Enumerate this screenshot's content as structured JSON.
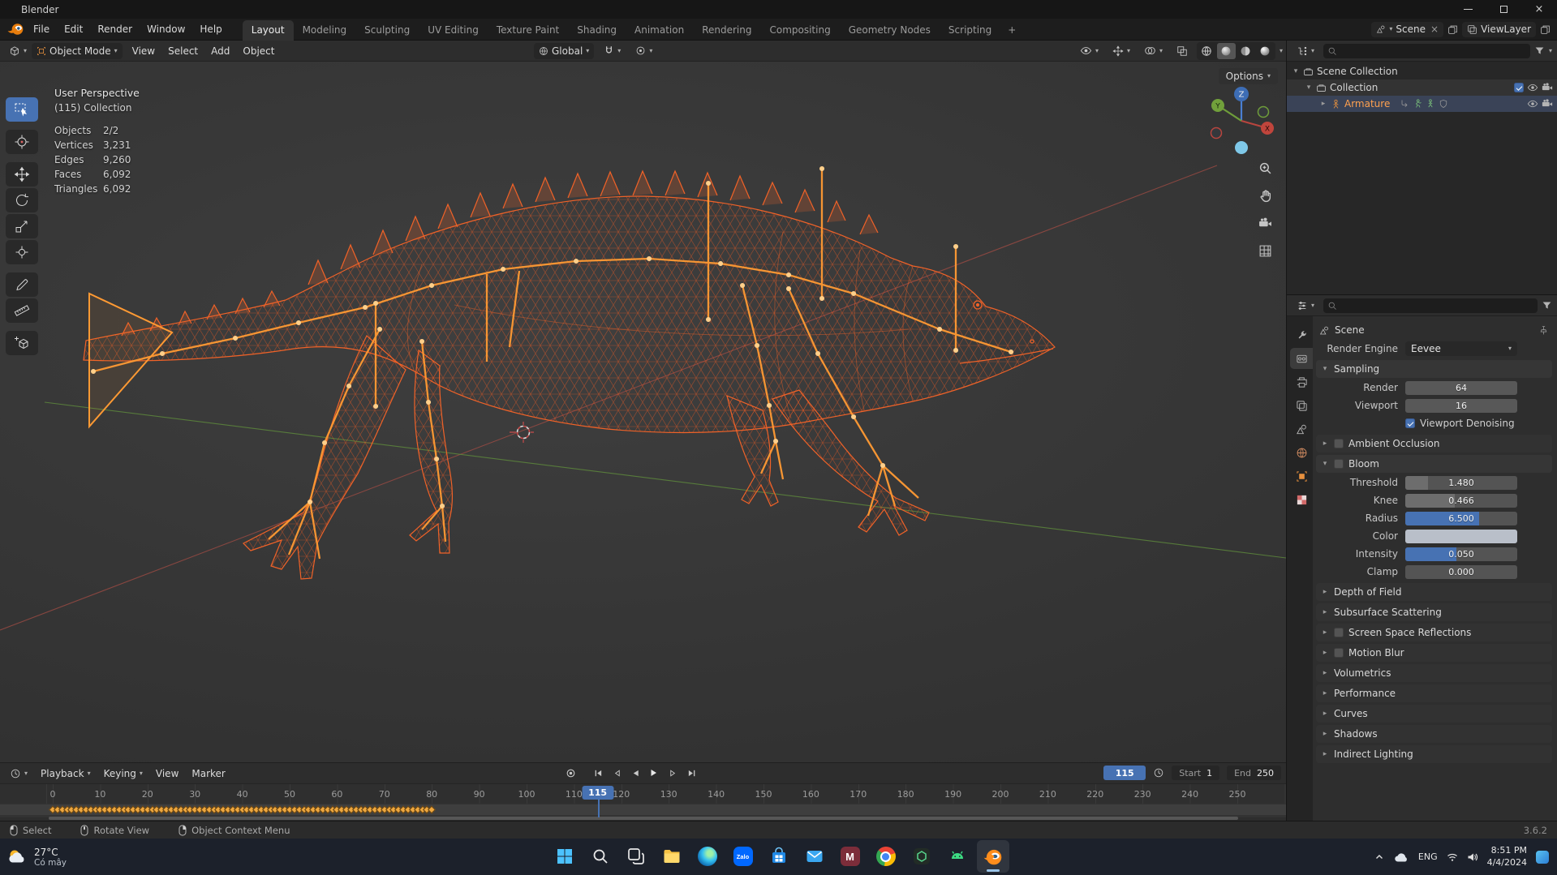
{
  "titlebar": {
    "title": "Blender"
  },
  "menubar": {
    "items": [
      "File",
      "Edit",
      "Render",
      "Window",
      "Help"
    ]
  },
  "workspaces": {
    "tabs": [
      "Layout",
      "Modeling",
      "Sculpting",
      "UV Editing",
      "Texture Paint",
      "Shading",
      "Animation",
      "Rendering",
      "Compositing",
      "Geometry Nodes",
      "Scripting"
    ],
    "active_index": 0,
    "add_label": "+"
  },
  "scene_widgets": {
    "scene": "Scene",
    "viewlayer": "ViewLayer"
  },
  "viewport": {
    "header": {
      "mode": "Object Mode",
      "menus": [
        "View",
        "Select",
        "Add",
        "Object"
      ],
      "orientation": "Global",
      "options": "Options"
    },
    "overlay": {
      "view_label": "User Perspective",
      "collection_label": "(115) Collection",
      "stats": [
        {
          "label": "Objects",
          "value": "2/2"
        },
        {
          "label": "Vertices",
          "value": "3,231"
        },
        {
          "label": "Edges",
          "value": "9,260"
        },
        {
          "label": "Faces",
          "value": "6,092"
        },
        {
          "label": "Triangles",
          "value": "6,092"
        }
      ]
    },
    "gizmo": {
      "x": "X",
      "y": "Y",
      "z": "Z"
    }
  },
  "tools": [
    {
      "name": "select-box",
      "active": true
    },
    {
      "name": "cursor-3d",
      "active": false
    },
    {
      "name": "move",
      "active": false
    },
    {
      "name": "rotate",
      "active": false
    },
    {
      "name": "scale",
      "active": false
    },
    {
      "name": "transform",
      "active": false
    },
    {
      "name": "annotate",
      "active": false
    },
    {
      "name": "measure",
      "active": false
    },
    {
      "name": "add-cube",
      "active": false
    }
  ],
  "outliner": {
    "items": [
      {
        "label": "Scene Collection",
        "depth": 0
      },
      {
        "label": "Collection",
        "depth": 1
      },
      {
        "label": "Armature",
        "depth": 2
      }
    ]
  },
  "properties": {
    "tabs": [
      "tool",
      "render",
      "output",
      "view-layer",
      "scene",
      "world",
      "object",
      "texture"
    ],
    "active_tab": "render",
    "breadcrumb": "Scene",
    "engine_label": "Render Engine",
    "engine_value": "Eevee",
    "sampling": {
      "title": "Sampling",
      "render_label": "Render",
      "render_value": "64",
      "viewport_label": "Viewport",
      "viewport_value": "16",
      "denoise_label": "Viewport Denoising",
      "denoise_checked": true
    },
    "ambient_occlusion": {
      "title": "Ambient Occlusion"
    },
    "bloom": {
      "title": "Bloom",
      "rows": [
        {
          "label": "Threshold",
          "value": "1.480",
          "fill": 20,
          "color": "#6d6d6d"
        },
        {
          "label": "Knee",
          "value": "0.466",
          "fill": 44,
          "color": "#6d6d6d"
        },
        {
          "label": "Radius",
          "value": "6.500",
          "fill": 66,
          "color": "#4772b3"
        },
        {
          "label": "Color",
          "value": "",
          "swatch": "#b9bfc9"
        },
        {
          "label": "Intensity",
          "value": "0.050",
          "fill": 46,
          "color": "#4772b3"
        },
        {
          "label": "Clamp",
          "value": "0.000",
          "fill": 0,
          "color": "#6d6d6d"
        }
      ]
    },
    "collapsed": [
      {
        "label": "Depth of Field",
        "checkbox": false
      },
      {
        "label": "Subsurface Scattering",
        "checkbox": false
      },
      {
        "label": "Screen Space Reflections",
        "checkbox": true
      },
      {
        "label": "Motion Blur",
        "checkbox": true
      },
      {
        "label": "Volumetrics",
        "checkbox": false
      },
      {
        "label": "Performance",
        "checkbox": false
      },
      {
        "label": "Curves",
        "checkbox": false
      },
      {
        "label": "Shadows",
        "checkbox": false
      },
      {
        "label": "Indirect Lighting",
        "checkbox": false
      }
    ]
  },
  "timeline": {
    "menus": [
      "Playback",
      "Keying",
      "View",
      "Marker"
    ],
    "current_frame": "115",
    "start_label": "Start",
    "start_value": "1",
    "end_label": "End",
    "end_value": "250",
    "ruler": {
      "min": 0,
      "max": 250,
      "step": 10
    },
    "keyframes": {
      "from": 0,
      "to": 80
    },
    "playhead": 115
  },
  "statusbar": {
    "hints": [
      {
        "icon": "mouse-left",
        "label": "Select"
      },
      {
        "icon": "mouse-middle",
        "label": "Rotate View"
      },
      {
        "icon": "mouse-right",
        "label": "Object Context Menu"
      }
    ],
    "version": "3.6.2"
  },
  "taskbar": {
    "weather": {
      "temp": "27°C",
      "condition": "Có mây"
    },
    "apps": [
      {
        "name": "start"
      },
      {
        "name": "search"
      },
      {
        "name": "task-view"
      },
      {
        "name": "file-explorer"
      },
      {
        "name": "edge"
      },
      {
        "name": "zalo",
        "label": "Zalo"
      },
      {
        "name": "store"
      },
      {
        "name": "mail"
      },
      {
        "name": "m-app",
        "label": "M"
      },
      {
        "name": "chrome"
      },
      {
        "name": "green-app"
      },
      {
        "name": "android"
      },
      {
        "name": "blender",
        "active": true
      }
    ],
    "tray": {
      "lang": "ENG",
      "time": "8:51 PM",
      "date": "4/4/2024"
    }
  }
}
